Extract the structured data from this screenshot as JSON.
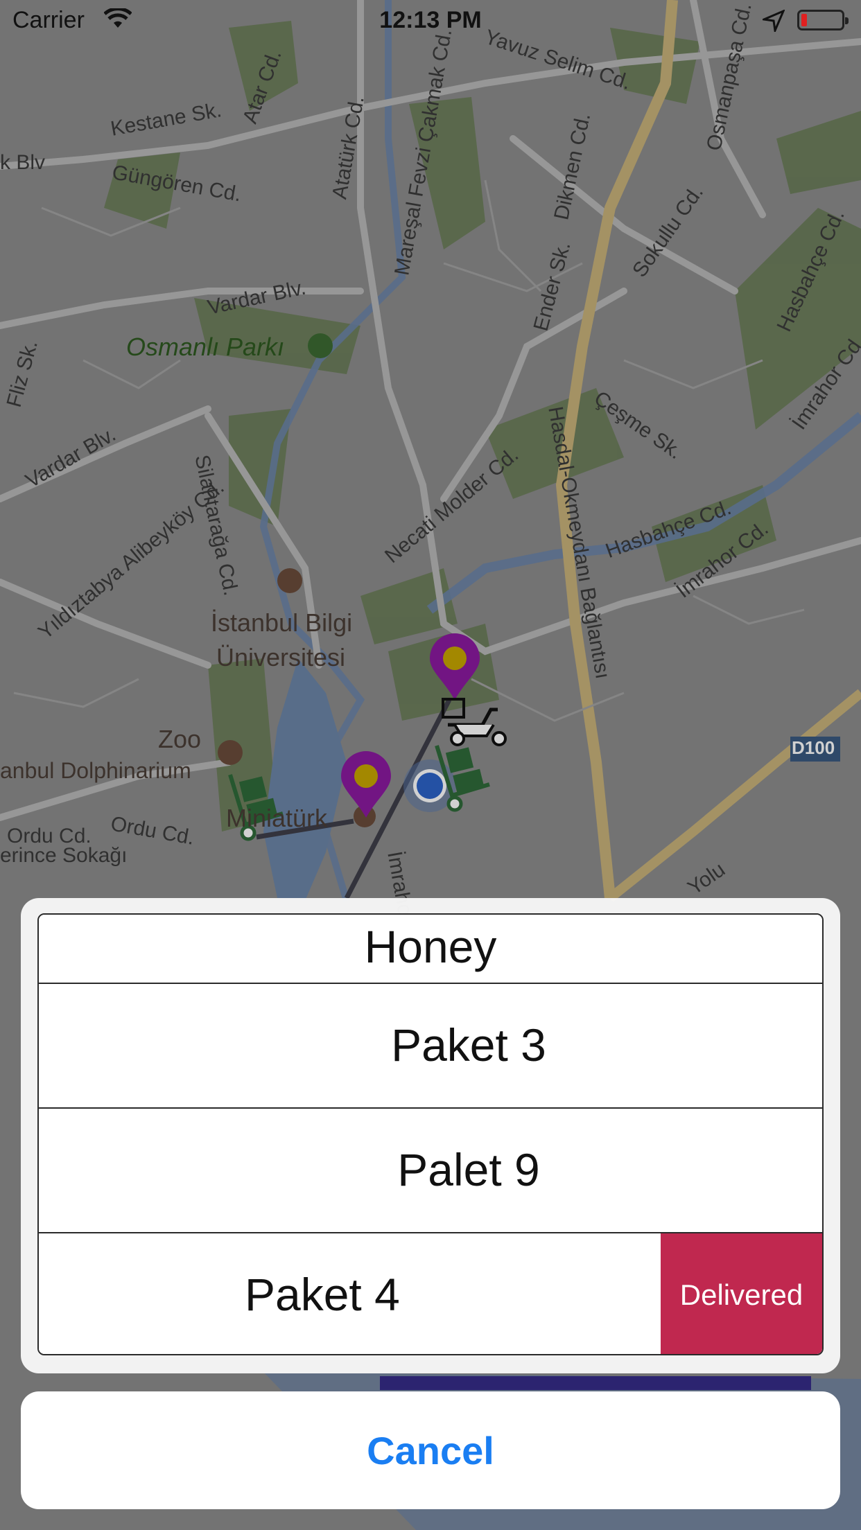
{
  "status_bar": {
    "carrier": "Carrier",
    "time": "12:13 PM"
  },
  "map": {
    "labels": [
      "Yavuz Selim Cd.",
      "Osmanpaşa Cd.",
      "Atar Cd.",
      "Kestane Sk.",
      "Güngören Cd.",
      "k Blv",
      "Atatürk Cd.",
      "Mareşal Fevzi Çakmak Cd.",
      "Dikmen Cd.",
      "Sokullu Cd.",
      "Hasbahçe Cd.",
      "Vardar Blv.",
      "Ender Sk.",
      "Osmanlı Parkı",
      "Fliz Sk.",
      "Vardar Blv.",
      "Hasdal-Okmeydanı Bağlantısı",
      "Çeşme Sk.",
      "İmrahor Cd.",
      "Silahtarağa Cd.",
      "Necati Molder Cd.",
      "Hasbahçe Cd.",
      "İmrahor Cd.",
      "Yıldıztabya Alibeyköy Cd.",
      "İstanbul Bilgi",
      "Üniversitesi",
      "Zoo",
      "anbul Dolphinarium",
      "Miniatürk",
      "Ordu Cd.",
      "Ordu Cd.",
      "erince Sokağı",
      "İmrahor",
      "D100",
      "Yolu"
    ]
  },
  "sheet": {
    "rows": [
      {
        "label": "Honey"
      },
      {
        "label": "Paket 3"
      },
      {
        "label": "Palet 9"
      },
      {
        "label": "Paket 4"
      }
    ],
    "swipe_action": "Delivered",
    "cancel_label": "Cancel"
  },
  "colors": {
    "accent": "#1a7ef2",
    "delivered": "#c0284f",
    "pin": "#8b1aa0",
    "pin_dot": "#c7a600",
    "cart": "#2f6b3a"
  }
}
